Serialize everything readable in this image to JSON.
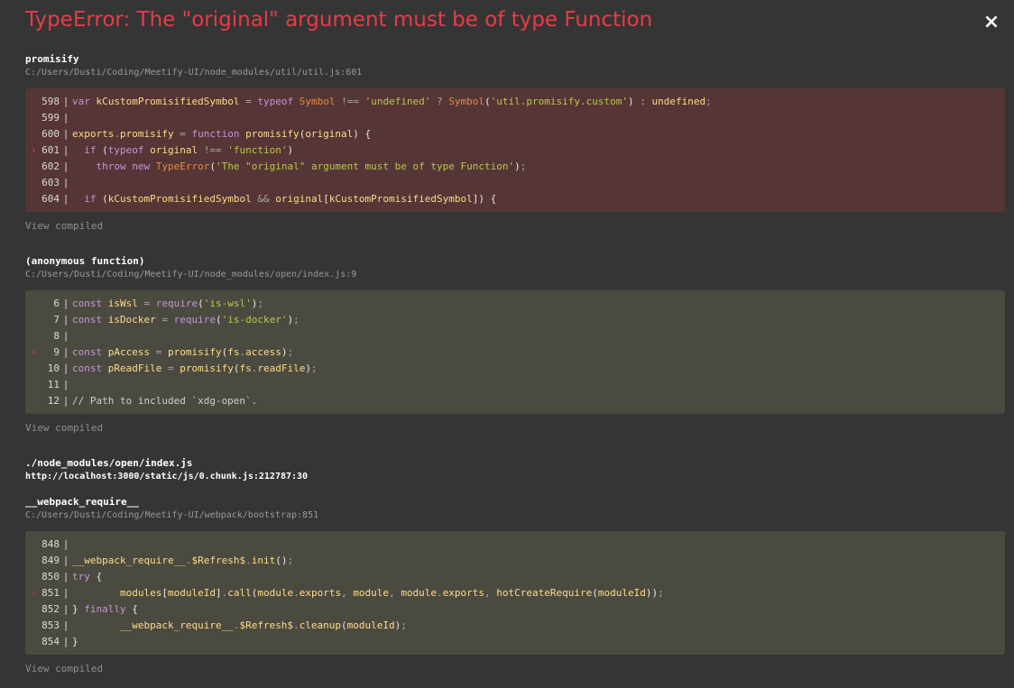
{
  "error_title": "TypeError: The \"original\" argument must be of type Function",
  "close_label": "×",
  "view_compiled_label": "View compiled",
  "frames": [
    {
      "name": "promisify",
      "location": "C:/Users/Dusti/Coding/Meetify-UI/node_modules/util/util.js:601",
      "kind": "err",
      "lines": [
        {
          "num": "598",
          "current": false,
          "code": "var kCustomPromisifiedSymbol = typeof Symbol !== 'undefined' ? Symbol('util.promisify.custom') : undefined;"
        },
        {
          "num": "599",
          "current": false,
          "code": ""
        },
        {
          "num": "600",
          "current": false,
          "code": "exports.promisify = function promisify(original) {"
        },
        {
          "num": "601",
          "current": true,
          "code": "  if (typeof original !== 'function')"
        },
        {
          "num": "602",
          "current": false,
          "code": "    throw new TypeError('The \"original\" argument must be of type Function');"
        },
        {
          "num": "603",
          "current": false,
          "code": ""
        },
        {
          "num": "604",
          "current": false,
          "code": "  if (kCustomPromisifiedSymbol && original[kCustomPromisifiedSymbol]) {"
        }
      ]
    },
    {
      "name": "(anonymous function)",
      "location": "C:/Users/Dusti/Coding/Meetify-UI/node_modules/open/index.js:9",
      "kind": "ok",
      "lines": [
        {
          "num": "6",
          "current": false,
          "code": "const isWsl = require('is-wsl');"
        },
        {
          "num": "7",
          "current": false,
          "code": "const isDocker = require('is-docker');"
        },
        {
          "num": "8",
          "current": false,
          "code": ""
        },
        {
          "num": "9",
          "current": true,
          "code": "const pAccess = promisify(fs.access);"
        },
        {
          "num": "10",
          "current": false,
          "code": "const pReadFile = promisify(fs.readFile);"
        },
        {
          "num": "11",
          "current": false,
          "code": ""
        },
        {
          "num": "12",
          "current": false,
          "code": "// Path to included `xdg-open`."
        }
      ]
    },
    {
      "name": "./node_modules/open/index.js",
      "location": "http://localhost:3000/static/js/0.chunk.js:212787:30",
      "kind": "none",
      "lines": []
    },
    {
      "name": "__webpack_require__",
      "location": "C:/Users/Dusti/Coding/Meetify-UI/webpack/bootstrap:851",
      "kind": "ok",
      "lines": [
        {
          "num": "848",
          "current": false,
          "code": ""
        },
        {
          "num": "849",
          "current": false,
          "code": "__webpack_require__.$Refresh$.init();"
        },
        {
          "num": "850",
          "current": false,
          "code": "try {"
        },
        {
          "num": "851",
          "current": true,
          "code": "        modules[moduleId].call(module.exports, module, module.exports, hotCreateRequire(moduleId));"
        },
        {
          "num": "852",
          "current": false,
          "code": "} finally {"
        },
        {
          "num": "853",
          "current": false,
          "code": "        __webpack_require__.$Refresh$.cleanup(moduleId);"
        },
        {
          "num": "854",
          "current": false,
          "code": "}"
        }
      ]
    }
  ],
  "colors": {
    "title": "#e83b46",
    "error_block": "#553535",
    "context_block": "#4b4a40",
    "background": "#353535"
  }
}
